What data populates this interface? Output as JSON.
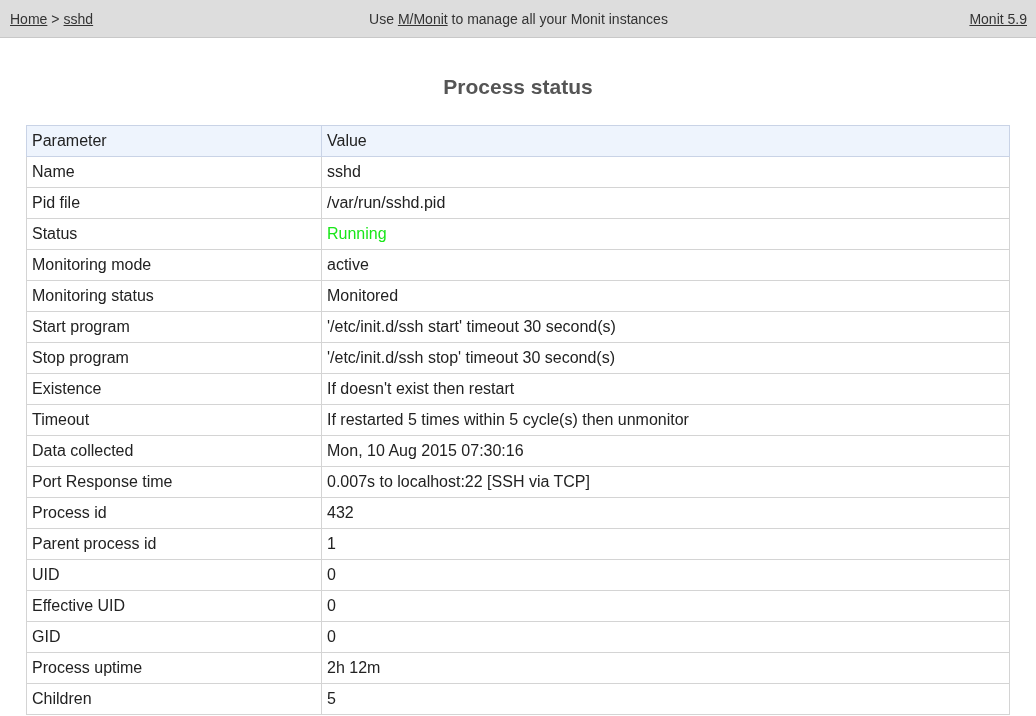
{
  "header": {
    "breadcrumb": [
      {
        "label": "Home"
      },
      {
        "label": "sshd"
      }
    ],
    "breadcrumb_separator": ">",
    "notice": {
      "before": "Use ",
      "link": "M/Monit",
      "after": " to manage all your Monit instances"
    },
    "version_link": "Monit 5.9"
  },
  "title": "Process status",
  "table": {
    "columns": [
      "Parameter",
      "Value"
    ],
    "rows": [
      {
        "parameter": "Name",
        "value": "sshd",
        "kind": "plain"
      },
      {
        "parameter": "Pid file",
        "value": "/var/run/sshd.pid",
        "kind": "plain"
      },
      {
        "parameter": "Status",
        "value": "Running",
        "kind": "ok"
      },
      {
        "parameter": "Monitoring mode",
        "value": "active",
        "kind": "plain"
      },
      {
        "parameter": "Monitoring status",
        "value": "Monitored",
        "kind": "plain"
      },
      {
        "parameter": "Start program",
        "value": "'/etc/init.d/ssh start' timeout 30 second(s)",
        "kind": "plain"
      },
      {
        "parameter": "Stop program",
        "value": "'/etc/init.d/ssh stop' timeout 30 second(s)",
        "kind": "plain"
      },
      {
        "parameter": "Existence",
        "value": "If doesn't exist then restart",
        "kind": "plain"
      },
      {
        "parameter": "Timeout",
        "value": "If restarted 5 times within 5 cycle(s) then unmonitor",
        "kind": "plain"
      },
      {
        "parameter": "Data collected",
        "value": "Mon, 10 Aug 2015 07:30:16",
        "kind": "plain"
      },
      {
        "parameter": "Port Response time",
        "value": "0.007s to localhost:22 [SSH via TCP]",
        "kind": "plain"
      },
      {
        "parameter": "Process id",
        "value": "432",
        "kind": "plain"
      },
      {
        "parameter": "Parent process id",
        "value": "1",
        "kind": "plain"
      },
      {
        "parameter": "UID",
        "value": "0",
        "kind": "plain"
      },
      {
        "parameter": "Effective UID",
        "value": "0",
        "kind": "plain"
      },
      {
        "parameter": "GID",
        "value": "0",
        "kind": "plain"
      },
      {
        "parameter": "Process uptime",
        "value": "2h 12m",
        "kind": "plain"
      },
      {
        "parameter": "Children",
        "value": "5",
        "kind": "plain"
      }
    ]
  }
}
